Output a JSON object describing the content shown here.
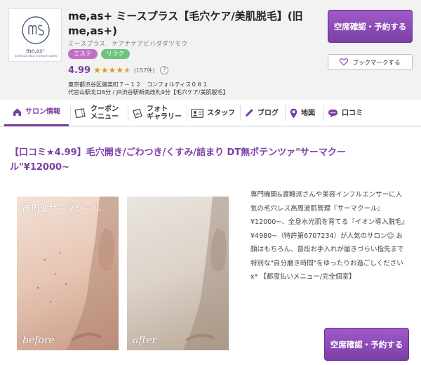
{
  "salon": {
    "logo_text": "me,as⁺",
    "logo_sub": "medical skin science salon",
    "title": "me,as+ ミースプラス【毛穴ケア/美肌脱毛】(旧me,as+)",
    "kana": "ミースプラス　ケアナケアビハダダツモウ",
    "tags": [
      "エステ",
      "リラク"
    ],
    "rating": "4.99",
    "review_count": "(157件)",
    "help": "?",
    "address": "東京都渋谷区猿楽町７－１２　コンフォルティス０８１",
    "access": "代官山駅北口6分 / JR渋谷駅新南改札9分【毛穴ケア/美肌脱毛】"
  },
  "buttons": {
    "reserve": "空席確認・予約する",
    "bookmark": "ブックマークする"
  },
  "nav": {
    "items": [
      {
        "label": "サロン情報",
        "icon": "house-icon"
      },
      {
        "label": "クーポン\nメニュー",
        "icon": "ticket-icon"
      },
      {
        "label": "フォト\nギャラリー",
        "icon": "photo-icon"
      },
      {
        "label": "スタッフ",
        "icon": "staff-icon"
      },
      {
        "label": "ブログ",
        "icon": "pencil-icon"
      },
      {
        "label": "地図",
        "icon": "map-pin-icon"
      },
      {
        "label": "口コミ",
        "icon": "chat-icon"
      }
    ]
  },
  "content": {
    "headline": "【口コミ★4.99】毛穴開き/ごわつき/くすみ/詰まり DT無ポテンツァ\"サーマクール\"¥12000~",
    "photo_caption": "高周波サーマクール",
    "before_label": "before",
    "after_label": "after",
    "description": "専門機関&渡韓派さんや美容インフルエンサーに人気の毛穴レス高周波肌管理『サーマクール』¥12000~、全身水光肌を育てる『イオン導入脱毛』¥4980~（特許第6707234）が人気のサロン☺ お顔はもちろん、普段お手入れが届きづらい指先まで特別な\"自分磨き時間\"をゆったりお過ごしくださいⅹ* 【都度払いメニュー/完全個室】"
  },
  "colors": {
    "accent": "#7b3fa5",
    "star": "#d4a017",
    "tag_esthe": "#c46ec8",
    "tag_relax": "#6cc47e"
  }
}
